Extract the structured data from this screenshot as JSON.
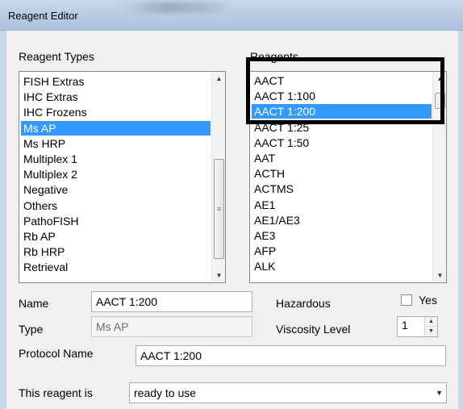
{
  "window": {
    "title": "Reagent Editor"
  },
  "reagent_types": {
    "label": "Reagent Types",
    "items": [
      "FISH Extras",
      "IHC Extras",
      "IHC Frozens",
      "Ms AP",
      "Ms HRP",
      "Multiplex 1",
      "Multiplex 2",
      "Negative",
      "Others",
      "PathoFISH",
      "Rb AP",
      "Rb HRP",
      "Retrieval"
    ],
    "selected": "Ms AP"
  },
  "reagents": {
    "label": "Reagents",
    "items": [
      "AACT",
      "AACT 1:100",
      "AACT 1:200",
      "AACT 1:25",
      "AACT 1:50",
      "AAT",
      "ACTH",
      "ACTMS",
      "AE1",
      "AE1/AE3",
      "AE3",
      "AFP",
      "ALK"
    ],
    "selected": "AACT 1:200"
  },
  "form": {
    "name_label": "Name",
    "name_value": "AACT 1:200",
    "type_label": "Type",
    "type_value": "Ms AP",
    "hazardous_label": "Hazardous",
    "hazardous_option": "Yes",
    "hazardous_checked": false,
    "viscosity_label": "Viscosity Level",
    "viscosity_value": "1",
    "protocol_label": "Protocol Name",
    "protocol_value": "AACT 1:200",
    "reagent_is_label": "This reagent is",
    "reagent_is_value": "ready to use"
  },
  "icons": {
    "scroll_up": "▲",
    "scroll_down": "▼",
    "scroll_grip": "≡",
    "dropdown": "▼"
  }
}
